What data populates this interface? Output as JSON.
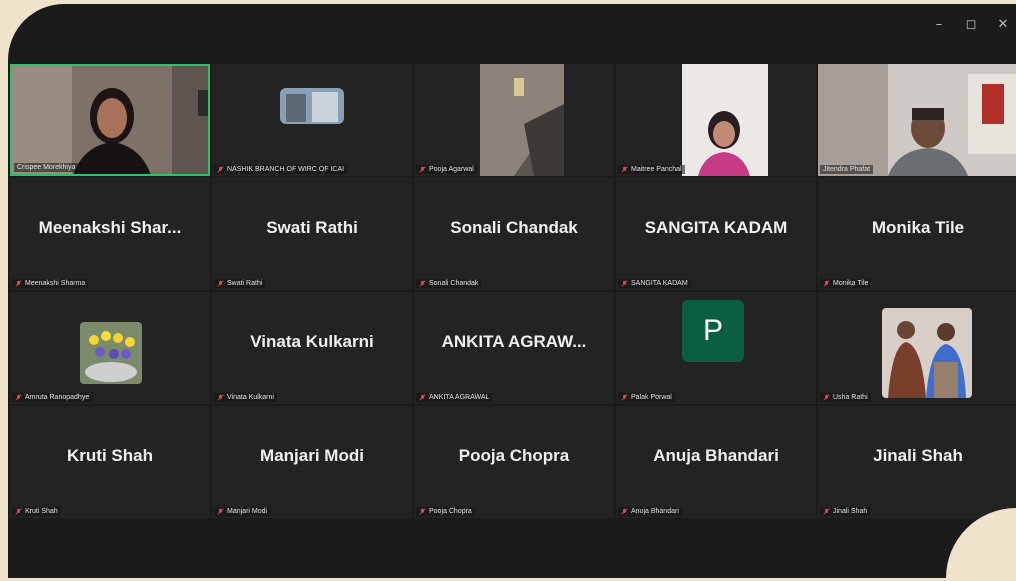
{
  "window": {
    "minimize_glyph": "–",
    "maximize_glyph": "◻",
    "close_glyph": "✕"
  },
  "colors": {
    "active_border": "#29c46a",
    "muted_mic": "#e5484d",
    "tile_bg": "#232323",
    "avatar_p": "#0b5e40"
  },
  "participants": [
    {
      "display_name": "",
      "label": "Crispee Morekhiya",
      "video": true,
      "active": true
    },
    {
      "display_name": "",
      "label": "NASHIK BRANCH OF WIRC OF ICAI",
      "video": true
    },
    {
      "display_name": "",
      "label": "Pooja Agarwal",
      "video": true
    },
    {
      "display_name": "",
      "label": "Maitree Panchal",
      "video": true
    },
    {
      "display_name": "",
      "label": "Jitendra Phafat",
      "video": true
    },
    {
      "display_name": "Meenakshi  Shar...",
      "label": "Meenakshi Sharma"
    },
    {
      "display_name": "Swati Rathi",
      "label": "Swati Rathi"
    },
    {
      "display_name": "Sonali Chandak",
      "label": "Sonali Chandak"
    },
    {
      "display_name": "SANGITA KADAM",
      "label": "SANGITA KADAM"
    },
    {
      "display_name": "Monika Tile",
      "label": "Monika Tile"
    },
    {
      "display_name": "",
      "label": "Amruta Ranopadhye",
      "video": true
    },
    {
      "display_name": "Vinata Kulkarni",
      "label": "Vinata Kulkarni"
    },
    {
      "display_name": "ANKITA  AGRAW...",
      "label": "ANKITA AGRAWAL"
    },
    {
      "display_name": "",
      "label": "Palak Porwal",
      "avatar_letter": "P"
    },
    {
      "display_name": "",
      "label": "Usha Rathi",
      "video": true
    },
    {
      "display_name": "Kruti Shah",
      "label": "Kruti Shah"
    },
    {
      "display_name": "Manjari Modi",
      "label": "Manjari Modi"
    },
    {
      "display_name": "Pooja Chopra",
      "label": "Pooja Chopra"
    },
    {
      "display_name": "Anuja Bhandari",
      "label": "Anuja Bhandari"
    },
    {
      "display_name": "Jinali Shah",
      "label": "Jinali Shah"
    }
  ]
}
